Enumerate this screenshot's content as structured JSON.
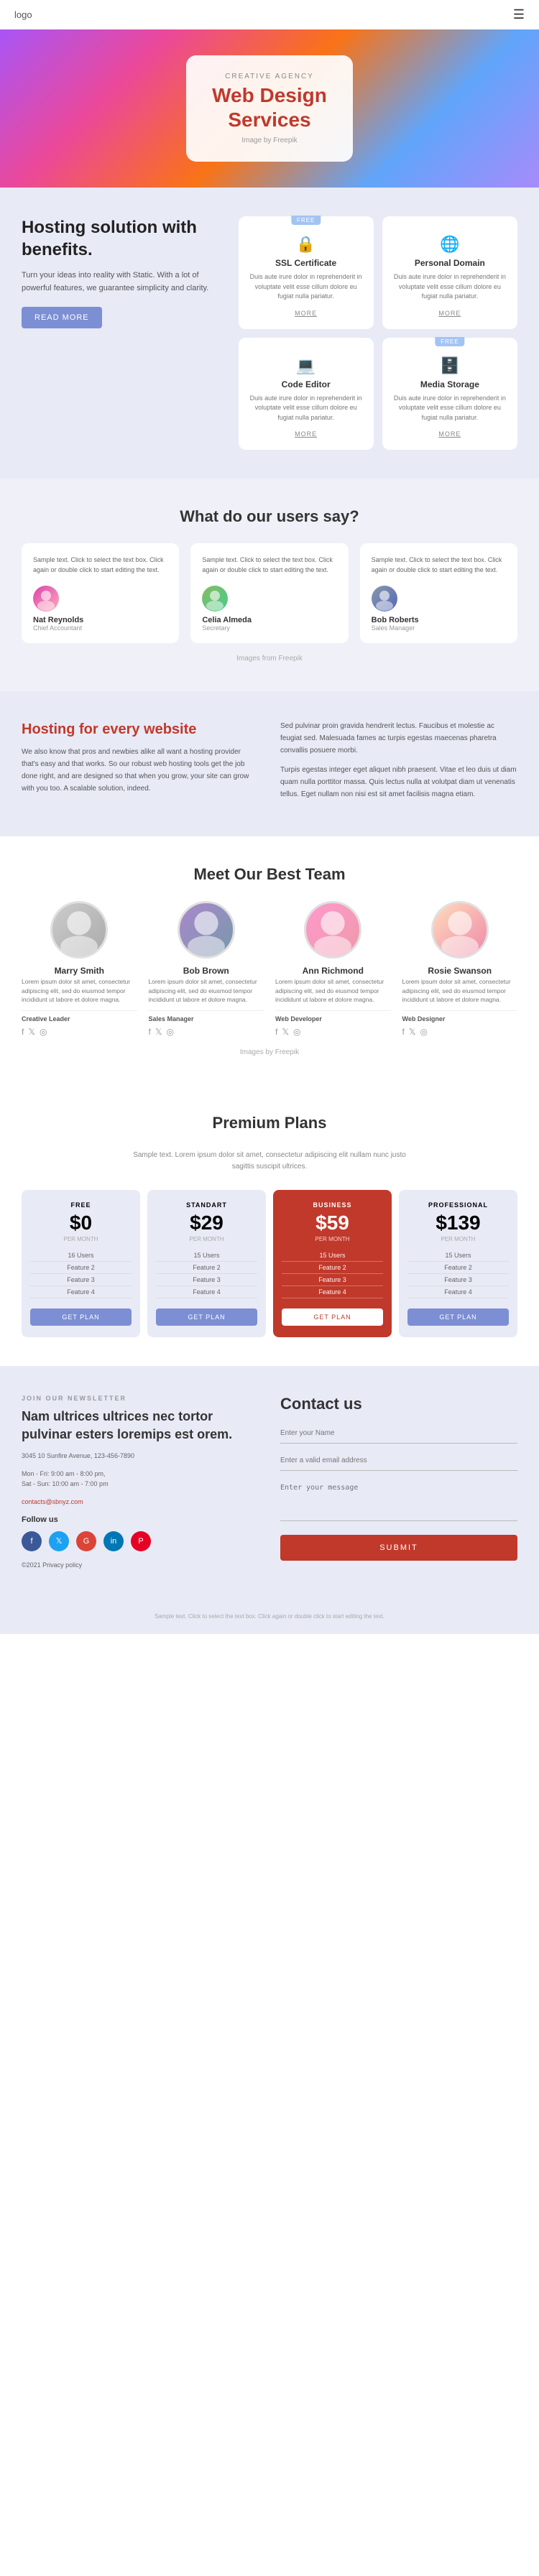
{
  "header": {
    "logo": "logo",
    "menu_icon": "☰"
  },
  "hero": {
    "subtitle": "CREATIVE AGENCY",
    "title": "Web Design\nServices",
    "image_credit": "Image by Freepik",
    "freepik_link": "Freepik"
  },
  "hosting": {
    "heading": "Hosting solution with benefits.",
    "description": "Turn your ideas into reality with Static. With a lot of powerful features, we guarantee simplicity and clarity.",
    "read_more": "READ MORE",
    "features": [
      {
        "id": "ssl",
        "badge": "FREE",
        "show_badge": true,
        "icon": "🔒",
        "title": "SSL Certificate",
        "desc": "Duis aute irure dolor in reprehenderit in voluptate velit esse cillum dolore eu fugiat nulla pariatur.",
        "more": "MORE"
      },
      {
        "id": "domain",
        "badge": "",
        "show_badge": false,
        "icon": "🌐",
        "title": "Personal Domain",
        "desc": "Duis aute irure dolor in reprehenderit in voluptate velit esse cillum dolore eu fugiat nulla pariatur.",
        "more": "MORE"
      },
      {
        "id": "editor",
        "badge": "",
        "show_badge": false,
        "icon": "💻",
        "title": "Code Editor",
        "desc": "Duis aute irure dolor in reprehenderit in voluptate velit esse cillum dolore eu fugiat nulla pariatur.",
        "more": "MORE"
      },
      {
        "id": "storage",
        "badge": "FREE",
        "show_badge": true,
        "icon": "🗄️",
        "title": "Media Storage",
        "desc": "Duis aute irure dolor in reprehenderit in voluptate velit esse cillum dolore eu fugiat nulla pariatur.",
        "more": "MORE"
      }
    ]
  },
  "testimonials": {
    "section_title": "What do our users say?",
    "cards": [
      {
        "text": "Sample text. Click to select the text box. Click again or double click to start editing the text.",
        "avatar": "av-nat",
        "name": "Nat Reynolds",
        "role": "Chief Accountant"
      },
      {
        "text": "Sample text. Click to select the text box. Click again or double click to start editing the text.",
        "avatar": "av-celia",
        "name": "Celia Almeda",
        "role": "Secretary"
      },
      {
        "text": "Sample text. Click to select the text box. Click again or double click to start editing the text.",
        "avatar": "av-bob",
        "name": "Bob Roberts",
        "role": "Sales Manager"
      }
    ],
    "images_credit": "Images from Freepik"
  },
  "hosting_every": {
    "heading": "Hosting for every website",
    "left_text": "We also know that pros and newbies alike all want a hosting provider that's easy and that works. So our robust web hosting tools get the job done right, and are designed so that when you grow, your site can grow with you too. A scalable solution, indeed.",
    "right_para1": "Sed pulvinar proin gravida hendrerit lectus. Faucibus et molestie ac feugiat sed. Malesuada fames ac turpis egestas maecenas pharetra convallis posuere morbi.",
    "right_para2": "Turpis egestas integer eget aliquet nibh praesent. Vitae et leo duis ut diam quam nulla porttitor massa. Quis lectus nulla at volutpat diam ut venenatis tellus. Eget nullam non nisi est sit amet facilisis magna etiam."
  },
  "team": {
    "section_title": "Meet Our Best Team",
    "members": [
      {
        "name": "Marry Smith",
        "role": "Creative Leader",
        "desc": "Lorem ipsum dolor sit amet, consectetur adipiscing elit, sed do eiusmod tempor incididunt ut labore et dolore magna.",
        "avatar": "av-marry"
      },
      {
        "name": "Bob Brown",
        "role": "Sales Manager",
        "desc": "Lorem ipsum dolor sit amet, consectetur adipiscing elit, sed do eiusmod tempor incididunt ut labore et dolore magna.",
        "avatar": "av-brown"
      },
      {
        "name": "Ann Richmond",
        "role": "Web Developer",
        "desc": "Lorem ipsum dolor sit amet, consectetur adipiscing elit, sed do eiusmod tempor incididunt ut labore et dolore magna.",
        "avatar": "av-ann"
      },
      {
        "name": "Rosie Swanson",
        "role": "Web Designer",
        "desc": "Lorem ipsum dolor sit amet, consectetur adipiscing elit, sed do eiusmod tempor incididunt ut labore et dolore magna.",
        "avatar": "av-rosie"
      }
    ],
    "images_credit": "Images by Freepik"
  },
  "plans": {
    "section_title": "Premium Plans",
    "subtitle": "Sample text. Lorem ipsum dolor sit amet, consectetur adipiscing elit nullam nunc justo\nsagittis suscipit ultrices.",
    "items": [
      {
        "type": "FREE",
        "price": "$0",
        "period": "PER MONTH",
        "features": [
          "16 Users",
          "Feature 2",
          "Feature 3",
          "Feature 4"
        ],
        "btn": "GET PLAN",
        "style": "free"
      },
      {
        "type": "STANDART",
        "price": "$29",
        "period": "PER MONTH",
        "features": [
          "15 Users",
          "Feature 2",
          "Feature 3",
          "Feature 4"
        ],
        "btn": "GET PLAN",
        "style": "standart"
      },
      {
        "type": "BUSINESS",
        "price": "$59",
        "period": "PER MONTH",
        "features": [
          "15 Users",
          "Feature 2",
          "Feature 3",
          "Feature 4"
        ],
        "btn": "GET PLAN",
        "style": "business"
      },
      {
        "type": "PROFESSIONAL",
        "price": "$139",
        "period": "PER MONTH",
        "features": [
          "15 Users",
          "Feature 2",
          "Feature 3",
          "Feature 4"
        ],
        "btn": "GET PLAN",
        "style": "professional"
      }
    ]
  },
  "newsletter": {
    "label": "JOIN OUR NEWSLETTER",
    "heading": "Nam ultrices ultrices nec tortor pulvinar esters loremips est orem.",
    "address": "3045 10 Sunfire Avenue, 123-456-7890",
    "hours": "Mon - Fri: 9:00 am - 8:00 pm,\nSat - Sun: 10:00 am - 7:00 pm",
    "email": "contacts@sbnyz.com",
    "follow": "Follow us",
    "copyright": "©2021 Privacy policy"
  },
  "contact": {
    "heading": "Contact us",
    "name_placeholder": "Enter your Name",
    "email_placeholder": "Enter a valid email address",
    "message_placeholder": "Enter your message",
    "submit": "SUBMIT"
  },
  "footer": {
    "note": "Sample text. Click to select the text box. Click again or double click to start editing the text."
  }
}
